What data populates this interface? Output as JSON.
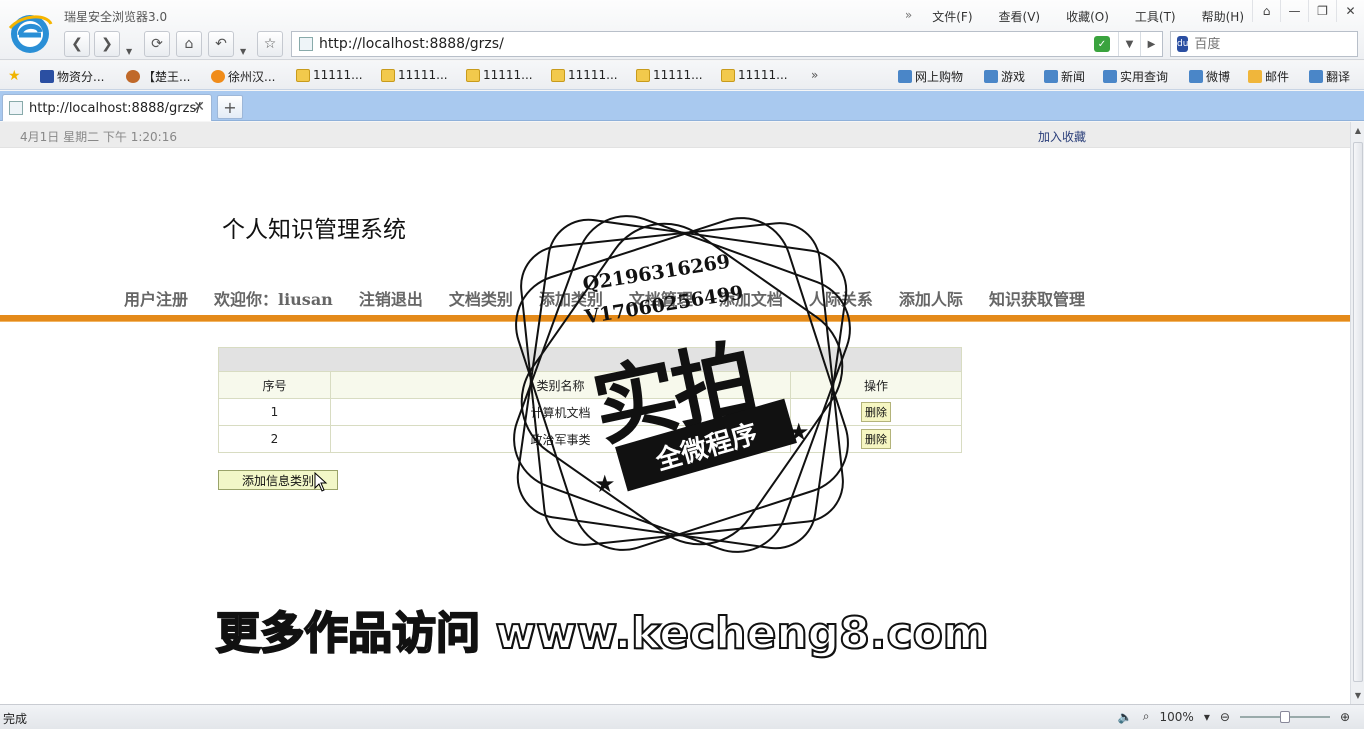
{
  "browser": {
    "app_title": "瑞星安全浏览器3.0",
    "menu": [
      "文件(F)",
      "查看(V)",
      "收藏(O)",
      "工具(T)",
      "帮助(H)"
    ],
    "url": "http://localhost:8888/grzs/",
    "search_placeholder": "百度",
    "favorites_left": [
      "物资分...",
      "【楚王...",
      "徐州汉...",
      "11111...",
      "11111...",
      "11111...",
      "11111...",
      "11111...",
      "11111..."
    ],
    "favorites_right": [
      "网上购物",
      "游戏",
      "新闻",
      "实用查询",
      "微博",
      "邮件",
      "翻译"
    ],
    "tab_title": "http://localhost:8888/grzs/",
    "status": "完成",
    "zoom": "100%"
  },
  "page": {
    "date": "4月1日 星期二 下午 1:20:16",
    "add_favorite": "加入收藏",
    "site_title": "个人知识管理系统",
    "nav": [
      "用户注册",
      "欢迎你：liusan",
      "注销退出",
      "文档类别",
      "添加类别",
      "文档管理",
      "添加文档",
      "人际关系",
      "添加人际",
      "知识获取管理"
    ],
    "table": {
      "headers": [
        "序号",
        "类别名称",
        "操作"
      ],
      "rows": [
        {
          "no": "1",
          "name": "计算机文档",
          "action": "删除"
        },
        {
          "no": "2",
          "name": "政治军事类",
          "action": "删除"
        }
      ]
    },
    "add_button": "添加信息类别"
  },
  "watermark": {
    "phone_q": "Q2196316269",
    "phone_v": "V17060256499",
    "big_text": "实拍",
    "ribbon": "全微程序",
    "promo": "更多作品访问 www.kecheng8.com"
  }
}
